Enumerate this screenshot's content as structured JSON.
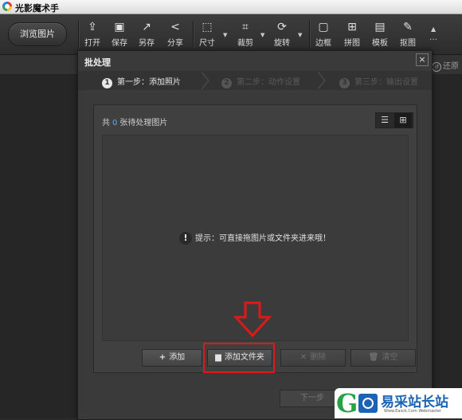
{
  "app": {
    "title": "光影魔术手"
  },
  "toolbar": {
    "browse_label": "浏览图片",
    "tools": [
      {
        "label": "打开",
        "icon": "open-icon"
      },
      {
        "label": "保存",
        "icon": "save-icon"
      },
      {
        "label": "另存",
        "icon": "save-as-icon"
      },
      {
        "label": "分享",
        "icon": "share-icon"
      },
      {
        "label": "尺寸",
        "icon": "resize-icon"
      },
      {
        "label": "裁剪",
        "icon": "crop-icon"
      },
      {
        "label": "旋转",
        "icon": "rotate-icon"
      },
      {
        "label": "边框",
        "icon": "border-icon"
      },
      {
        "label": "拼图",
        "icon": "collage-icon"
      },
      {
        "label": "模板",
        "icon": "template-icon"
      },
      {
        "label": "抠图",
        "icon": "cutout-icon"
      }
    ]
  },
  "background": {
    "restore_label": "还原"
  },
  "dialog": {
    "title": "批处理",
    "close": "×",
    "steps": [
      {
        "num": "1",
        "label": "第一步：添加照片",
        "active": true
      },
      {
        "num": "2",
        "label": "第二步：动作设置",
        "active": false
      },
      {
        "num": "3",
        "label": "第三步：输出设置",
        "active": false
      }
    ],
    "count_prefix": "共",
    "count_value": "0",
    "count_suffix": "张待处理图片",
    "hint": "提示：可直接拖图片或文件夹进来哦！",
    "buttons": {
      "add": "添加",
      "add_folder": "添加文件夹",
      "delete": "删除",
      "clear": "清空"
    },
    "next": "下一步"
  },
  "watermark": {
    "text": "易采站长站",
    "url": "Www.Easck.Com Webmaster"
  },
  "colors": {
    "highlight": "#e01818",
    "count_accent": "#5aa9ff"
  }
}
